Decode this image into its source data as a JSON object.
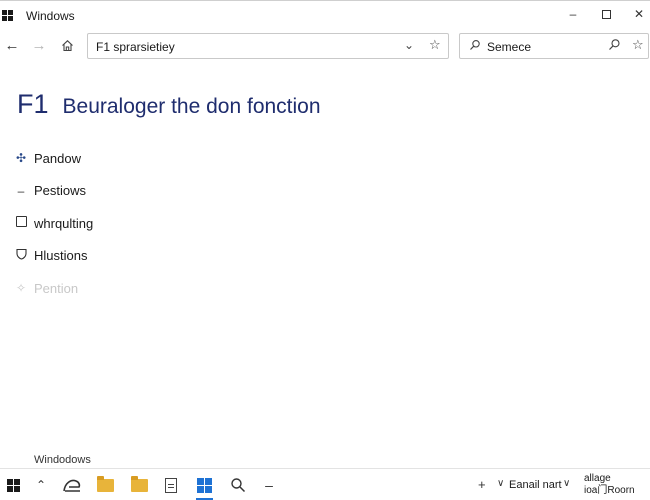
{
  "window": {
    "title": "Windows",
    "controls": {
      "minimize": "–",
      "maximize": "",
      "close": "✕"
    }
  },
  "nav": {
    "back_icon": "arrow-left-icon",
    "forward_icon": "arrow-right-icon",
    "home_icon": "home-icon",
    "address_value": "F1 sprarsietiey",
    "search_value": "Semece"
  },
  "content": {
    "heading_code": "F1",
    "heading_title": "Beuraloger the don fonction",
    "menu": [
      {
        "label": "Pandow",
        "icon": "plus-arrows-icon",
        "glyph": "✣",
        "enabled": true
      },
      {
        "label": "Pestiows",
        "icon": "minus-icon",
        "glyph": "–",
        "enabled": true
      },
      {
        "label": "whrqulting",
        "icon": "square-icon",
        "glyph": "",
        "enabled": true
      },
      {
        "label": "Hlustions",
        "icon": "shield-icon",
        "glyph": "⛉",
        "enabled": true
      },
      {
        "label": "Pention",
        "icon": "sparkle-icon",
        "glyph": "✧",
        "enabled": false
      }
    ],
    "footer": "Windodows"
  },
  "taskbar": {
    "tray_text": "Eanail nart",
    "clock_line1": "allage",
    "clock_line2": "ioa门Roorn"
  },
  "colors": {
    "heading": "#1f2d6e",
    "accent": "#1e72d4",
    "folder": "#e8b43a"
  }
}
